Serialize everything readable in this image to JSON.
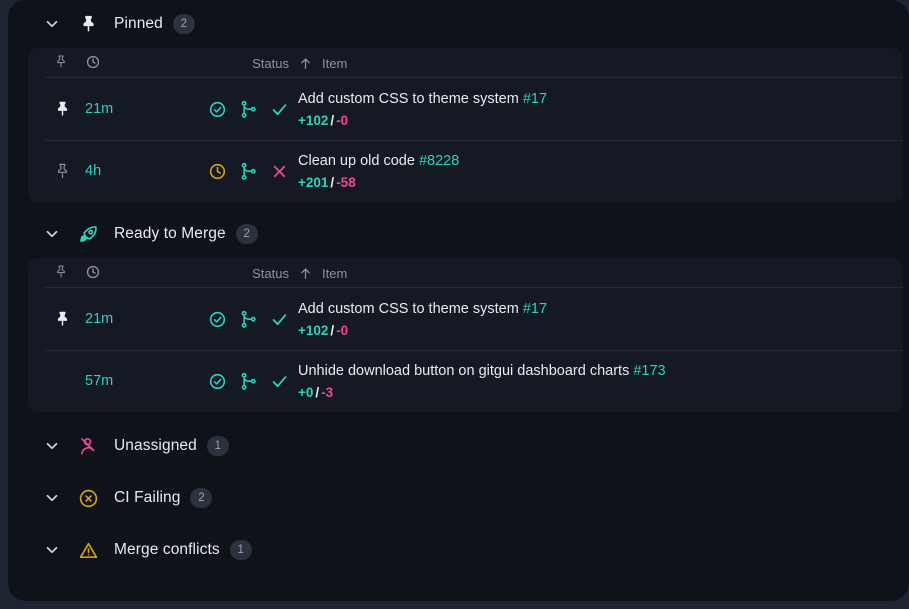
{
  "colors": {
    "page_background": "#1e2431",
    "panel_background": "#0e1219",
    "table_background": "#141924",
    "accent_teal": "#2bd4bd",
    "accent_pink": "#ec4899",
    "accent_amber": "#d4a017",
    "text_primary": "#e8ebf0",
    "text_muted": "#8b93a3",
    "badge_background": "#2b313d",
    "divider": "#242b39"
  },
  "columns": {
    "pin_icon": "pin-outline-icon",
    "time_icon": "clock-icon",
    "status_label": "Status",
    "item_label": "Item",
    "sort_icon": "arrow-up-icon"
  },
  "sections": [
    {
      "id": "pinned",
      "label": "Pinned",
      "count": "2",
      "icon": "pin-filled-icon",
      "icon_color": "#e8ebf0",
      "expanded": true,
      "chevron": "chevron-down-icon",
      "rows": [
        {
          "pinned": true,
          "pin_icon": "pin-filled-icon",
          "time": "21m",
          "status": [
            "check-circle-icon",
            "git-branch-icon",
            "check-icon"
          ],
          "status_colors": [
            "#2bd4bd",
            "#2bd4bd",
            "#2bd4bd"
          ],
          "title": "Add custom CSS to theme system",
          "number": "#17",
          "additions": "+102",
          "separator": "/",
          "deletions": "-0"
        },
        {
          "pinned": false,
          "pin_icon": "pin-outline-icon",
          "time": "4h",
          "status": [
            "clock-circle-icon",
            "git-branch-icon",
            "x-icon"
          ],
          "status_colors": [
            "#d4a017",
            "#2bd4bd",
            "#ec4899"
          ],
          "title": "Clean up old code",
          "number": "#8228",
          "additions": "+201",
          "separator": "/",
          "deletions": "-58"
        }
      ]
    },
    {
      "id": "ready-to-merge",
      "label": "Ready to Merge",
      "count": "2",
      "icon": "rocket-icon",
      "icon_color": "#2bd4bd",
      "expanded": true,
      "chevron": "chevron-down-icon",
      "rows": [
        {
          "pinned": true,
          "pin_icon": "pin-filled-icon",
          "time": "21m",
          "status": [
            "check-circle-icon",
            "git-branch-icon",
            "check-icon"
          ],
          "status_colors": [
            "#2bd4bd",
            "#2bd4bd",
            "#2bd4bd"
          ],
          "title": "Add custom CSS to theme system",
          "number": "#17",
          "additions": "+102",
          "separator": "/",
          "deletions": "-0"
        },
        {
          "pinned": false,
          "pin_icon": "none",
          "time": "57m",
          "status": [
            "check-circle-icon",
            "git-branch-icon",
            "check-icon"
          ],
          "status_colors": [
            "#2bd4bd",
            "#2bd4bd",
            "#2bd4bd"
          ],
          "title": "Unhide download button on gitgui dashboard charts",
          "number": "#173",
          "additions": "+0",
          "separator": "/",
          "deletions": "-3"
        }
      ]
    },
    {
      "id": "unassigned",
      "label": "Unassigned",
      "count": "1",
      "icon": "user-slash-icon",
      "icon_color": "#ec4899",
      "expanded": false,
      "chevron": "chevron-down-icon",
      "rows": []
    },
    {
      "id": "ci-failing",
      "label": "CI Failing",
      "count": "2",
      "icon": "x-circle-icon",
      "icon_color": "#d4a017",
      "expanded": false,
      "chevron": "chevron-down-icon",
      "rows": []
    },
    {
      "id": "merge-conflicts",
      "label": "Merge conflicts",
      "count": "1",
      "icon": "warning-triangle-icon",
      "icon_color": "#d4a017",
      "expanded": false,
      "chevron": "chevron-down-icon",
      "rows": []
    }
  ]
}
